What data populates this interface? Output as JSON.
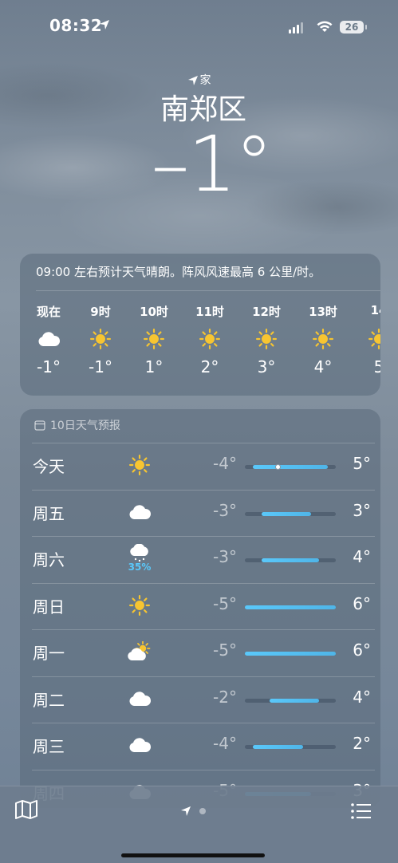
{
  "status_bar": {
    "time": "08:32",
    "battery": "26"
  },
  "location": {
    "home_label": "家",
    "city": "南郑区",
    "current_temp": "–1°"
  },
  "hourly": {
    "summary": "09:00 左右预计天气晴朗。阵风风速最高 6 公里/时。",
    "items": [
      {
        "label": "现在",
        "icon": "cloud-icon",
        "temp": "-1°"
      },
      {
        "label": "9时",
        "icon": "sun-icon",
        "temp": "-1°"
      },
      {
        "label": "10时",
        "icon": "sun-icon",
        "temp": "1°"
      },
      {
        "label": "11时",
        "icon": "sun-icon",
        "temp": "2°"
      },
      {
        "label": "12时",
        "icon": "sun-icon",
        "temp": "3°"
      },
      {
        "label": "13时",
        "icon": "sun-icon",
        "temp": "4°"
      },
      {
        "label": "14",
        "icon": "sun-icon",
        "temp": "5"
      }
    ]
  },
  "daily": {
    "header": "10日天气预报",
    "range": [
      -5,
      6
    ],
    "days": [
      {
        "day": "今天",
        "icon": "sun-icon",
        "pop": "",
        "low": "-4°",
        "high": "5°",
        "low_val": -4,
        "high_val": 5,
        "current_val": -1
      },
      {
        "day": "周五",
        "icon": "cloud-icon",
        "pop": "",
        "low": "-3°",
        "high": "3°",
        "low_val": -3,
        "high_val": 3
      },
      {
        "day": "周六",
        "icon": "cloud-snow-icon",
        "pop": "35%",
        "low": "-3°",
        "high": "4°",
        "low_val": -3,
        "high_val": 4
      },
      {
        "day": "周日",
        "icon": "sun-icon",
        "pop": "",
        "low": "-5°",
        "high": "6°",
        "low_val": -5,
        "high_val": 6
      },
      {
        "day": "周一",
        "icon": "partly-cloudy-icon",
        "pop": "",
        "low": "-5°",
        "high": "6°",
        "low_val": -5,
        "high_val": 6
      },
      {
        "day": "周二",
        "icon": "cloud-icon",
        "pop": "",
        "low": "-2°",
        "high": "4°",
        "low_val": -2,
        "high_val": 4
      },
      {
        "day": "周三",
        "icon": "cloud-icon",
        "pop": "",
        "low": "-4°",
        "high": "2°",
        "low_val": -4,
        "high_val": 2
      },
      {
        "day": "周四",
        "icon": "cloud-icon",
        "pop": "",
        "low": "-5°",
        "high": "3°",
        "low_val": -5,
        "high_val": 3
      }
    ]
  },
  "colors": {
    "accent_blue": "#5ac8fa",
    "sun_yellow": "#f7c531"
  }
}
